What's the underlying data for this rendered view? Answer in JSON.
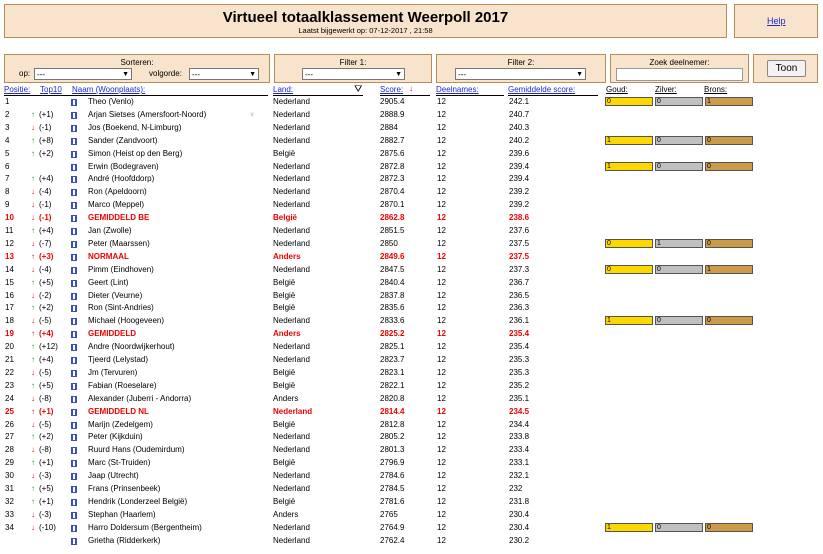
{
  "header": {
    "title": "Virtueel totaalklassement Weerpoll 2017",
    "subtitle": "Laatst bijgewerkt op: 07-12-2017 , 21:58",
    "help": "Help"
  },
  "controls": {
    "sort_label": "Sorteren:",
    "op_label": "op:",
    "op_value": "---",
    "order_label": "volgorde:",
    "order_value": "---",
    "filter1_label": "Filter 1:",
    "filter1_value": "---",
    "filter2_label": "Filter 2:",
    "filter2_value": "---",
    "search_label": "Zoek deelnemer:",
    "search_value": "",
    "toon_label": "Toon"
  },
  "columns": {
    "positie": "Positie:",
    "top10": "Top10",
    "naam": "Naam (Woonplaats):",
    "land": "Land:",
    "score": "Score:",
    "deelnames": "Deelnames:",
    "gemiddelde": "Gemiddelde score:",
    "goud": "Goud:",
    "zilver": "Zilver:",
    "brons": "Brons:"
  },
  "colors": {
    "panel": "#f8e4cc",
    "link": "#1a2ccb",
    "highlight": "#ee0000",
    "up": "#16a016",
    "down": "#d01010"
  },
  "rows": [
    {
      "pos": "1",
      "change": "",
      "dir": "",
      "name": "Theo (Venlo)",
      "country": "Nederland",
      "score": "2905.4",
      "games": "12",
      "avg": "242.1",
      "medals": [
        "0",
        "0",
        "1"
      ],
      "red": false,
      "trophy": false
    },
    {
      "pos": "2",
      "change": "(+1)",
      "dir": "up",
      "name": "Arjan Sietses (Amersfoort-Noord)",
      "country": "Nederland",
      "score": "2888.9",
      "games": "12",
      "avg": "240.7",
      "medals": null,
      "red": false,
      "trophy": true
    },
    {
      "pos": "3",
      "change": "(-1)",
      "dir": "down",
      "name": "Jos (Boekend, N-Limburg)",
      "country": "Nederland",
      "score": "2884",
      "games": "12",
      "avg": "240.3",
      "medals": null,
      "red": false,
      "trophy": false
    },
    {
      "pos": "4",
      "change": "(+8)",
      "dir": "up",
      "name": "Sander (Zandvoort)",
      "country": "Nederland",
      "score": "2882.7",
      "games": "12",
      "avg": "240.2",
      "medals": [
        "1",
        "0",
        "0"
      ],
      "red": false,
      "trophy": false
    },
    {
      "pos": "5",
      "change": "(+2)",
      "dir": "up",
      "name": "Simon (Heist op den Berg)",
      "country": "België",
      "score": "2875.6",
      "games": "12",
      "avg": "239.6",
      "medals": null,
      "red": false,
      "trophy": false
    },
    {
      "pos": "6",
      "change": "",
      "dir": "",
      "name": "Erwin (Bodegraven)",
      "country": "Nederland",
      "score": "2872.8",
      "games": "12",
      "avg": "239.4",
      "medals": [
        "1",
        "0",
        "0"
      ],
      "red": false,
      "trophy": false
    },
    {
      "pos": "7",
      "change": "(+4)",
      "dir": "up",
      "name": "André (Hoofddorp)",
      "country": "Nederland",
      "score": "2872.3",
      "games": "12",
      "avg": "239.4",
      "medals": null,
      "red": false,
      "trophy": false
    },
    {
      "pos": "8",
      "change": "(-4)",
      "dir": "down",
      "name": "Ron (Apeldoorn)",
      "country": "Nederland",
      "score": "2870.4",
      "games": "12",
      "avg": "239.2",
      "medals": null,
      "red": false,
      "trophy": false
    },
    {
      "pos": "9",
      "change": "(-1)",
      "dir": "down",
      "name": "Marco (Meppel)",
      "country": "Nederland",
      "score": "2870.1",
      "games": "12",
      "avg": "239.2",
      "medals": null,
      "red": false,
      "trophy": false
    },
    {
      "pos": "10",
      "change": "(-1)",
      "dir": "down",
      "name": "GEMIDDELD BE",
      "country": "België",
      "score": "2862.8",
      "games": "12",
      "avg": "238.6",
      "medals": null,
      "red": true,
      "trophy": false
    },
    {
      "pos": "11",
      "change": "(+4)",
      "dir": "up",
      "name": "Jan (Zwolle)",
      "country": "Nederland",
      "score": "2851.5",
      "games": "12",
      "avg": "237.6",
      "medals": null,
      "red": false,
      "trophy": false
    },
    {
      "pos": "12",
      "change": "(-7)",
      "dir": "down",
      "name": "Peter (Maarssen)",
      "country": "Nederland",
      "score": "2850",
      "games": "12",
      "avg": "237.5",
      "medals": [
        "0",
        "1",
        "0"
      ],
      "red": false,
      "trophy": false
    },
    {
      "pos": "13",
      "change": "(+3)",
      "dir": "up",
      "name": "NORMAAL",
      "country": "Anders",
      "score": "2849.6",
      "games": "12",
      "avg": "237.5",
      "medals": null,
      "red": true,
      "trophy": false
    },
    {
      "pos": "14",
      "change": "(-4)",
      "dir": "down",
      "name": "Pimm (Eindhoven)",
      "country": "Nederland",
      "score": "2847.5",
      "games": "12",
      "avg": "237.3",
      "medals": [
        "0",
        "0",
        "1"
      ],
      "red": false,
      "trophy": false
    },
    {
      "pos": "15",
      "change": "(+5)",
      "dir": "up",
      "name": "Geert (Lint)",
      "country": "België",
      "score": "2840.4",
      "games": "12",
      "avg": "236.7",
      "medals": null,
      "red": false,
      "trophy": false
    },
    {
      "pos": "16",
      "change": "(-2)",
      "dir": "down",
      "name": "Dieter (Veurne)",
      "country": "België",
      "score": "2837.8",
      "games": "12",
      "avg": "236.5",
      "medals": null,
      "red": false,
      "trophy": false
    },
    {
      "pos": "17",
      "change": "(+2)",
      "dir": "up",
      "name": "Ron (Sint-Andries)",
      "country": "België",
      "score": "2835.6",
      "games": "12",
      "avg": "236.3",
      "medals": null,
      "red": false,
      "trophy": false
    },
    {
      "pos": "18",
      "change": "(-5)",
      "dir": "down",
      "name": "Michael (Hoogeveen)",
      "country": "Nederland",
      "score": "2833.6",
      "games": "12",
      "avg": "236.1",
      "medals": [
        "1",
        "0",
        "0"
      ],
      "red": false,
      "trophy": false
    },
    {
      "pos": "19",
      "change": "(+4)",
      "dir": "up",
      "name": "GEMIDDELD",
      "country": "Anders",
      "score": "2825.2",
      "games": "12",
      "avg": "235.4",
      "medals": null,
      "red": true,
      "trophy": false
    },
    {
      "pos": "20",
      "change": "(+12)",
      "dir": "up",
      "name": "Andre (Noordwijkerhout)",
      "country": "Nederland",
      "score": "2825.1",
      "games": "12",
      "avg": "235.4",
      "medals": null,
      "red": false,
      "trophy": false
    },
    {
      "pos": "21",
      "change": "(+4)",
      "dir": "up",
      "name": "Tjeerd (Lelystad)",
      "country": "Nederland",
      "score": "2823.7",
      "games": "12",
      "avg": "235.3",
      "medals": null,
      "red": false,
      "trophy": false
    },
    {
      "pos": "22",
      "change": "(-5)",
      "dir": "down",
      "name": "Jm (Tervuren)",
      "country": "België",
      "score": "2823.1",
      "games": "12",
      "avg": "235.3",
      "medals": null,
      "red": false,
      "trophy": false
    },
    {
      "pos": "23",
      "change": "(+5)",
      "dir": "up",
      "name": "Fabian (Roeselare)",
      "country": "België",
      "score": "2822.1",
      "games": "12",
      "avg": "235.2",
      "medals": null,
      "red": false,
      "trophy": false
    },
    {
      "pos": "24",
      "change": "(-8)",
      "dir": "down",
      "name": "Alexander (Juberri - Andorra)",
      "country": "Anders",
      "score": "2820.8",
      "games": "12",
      "avg": "235.1",
      "medals": null,
      "red": false,
      "trophy": false
    },
    {
      "pos": "25",
      "change": "(+1)",
      "dir": "up",
      "name": "GEMIDDELD NL",
      "country": "Nederland",
      "score": "2814.4",
      "games": "12",
      "avg": "234.5",
      "medals": null,
      "red": true,
      "trophy": false
    },
    {
      "pos": "26",
      "change": "(-5)",
      "dir": "down",
      "name": "Marijn (Zedelgem)",
      "country": "België",
      "score": "2812.8",
      "games": "12",
      "avg": "234.4",
      "medals": null,
      "red": false,
      "trophy": false
    },
    {
      "pos": "27",
      "change": "(+2)",
      "dir": "up",
      "name": "Peter (Kijkduin)",
      "country": "Nederland",
      "score": "2805.2",
      "games": "12",
      "avg": "233.8",
      "medals": null,
      "red": false,
      "trophy": false
    },
    {
      "pos": "28",
      "change": "(-8)",
      "dir": "down",
      "name": "Ruurd Hans (Oudemirdum)",
      "country": "Nederland",
      "score": "2801.3",
      "games": "12",
      "avg": "233.4",
      "medals": null,
      "red": false,
      "trophy": false
    },
    {
      "pos": "29",
      "change": "(+1)",
      "dir": "up",
      "name": "Marc (St-Truiden)",
      "country": "België",
      "score": "2796.9",
      "games": "12",
      "avg": "233.1",
      "medals": null,
      "red": false,
      "trophy": false
    },
    {
      "pos": "30",
      "change": "(-3)",
      "dir": "down",
      "name": "Jaap (Utrecht)",
      "country": "Nederland",
      "score": "2784.6",
      "games": "12",
      "avg": "232.1",
      "medals": null,
      "red": false,
      "trophy": false
    },
    {
      "pos": "31",
      "change": "(+5)",
      "dir": "up",
      "name": "Frans (Prinsenbeek)",
      "country": "Nederland",
      "score": "2784.5",
      "games": "12",
      "avg": "232",
      "medals": null,
      "red": false,
      "trophy": false
    },
    {
      "pos": "32",
      "change": "(+1)",
      "dir": "up",
      "name": "Hendrik (Londerzeel België)",
      "country": "België",
      "score": "2781.6",
      "games": "12",
      "avg": "231.8",
      "medals": null,
      "red": false,
      "trophy": false
    },
    {
      "pos": "33",
      "change": "(-3)",
      "dir": "down",
      "name": "Stephan (Haarlem)",
      "country": "Anders",
      "score": "2765",
      "games": "12",
      "avg": "230.4",
      "medals": null,
      "red": false,
      "trophy": false
    },
    {
      "pos": "34",
      "change": "(-10)",
      "dir": "down",
      "name": "Harro Doldersum (Bergentheim)",
      "country": "Nederland",
      "score": "2764.9",
      "games": "12",
      "avg": "230.4",
      "medals": [
        "1",
        "0",
        "0"
      ],
      "red": false,
      "trophy": false
    },
    {
      "pos": "",
      "change": "",
      "dir": "",
      "name": "Grietha (Ridderkerk)",
      "country": "Nederland",
      "score": "2762.4",
      "games": "12",
      "avg": "230.2",
      "medals": null,
      "red": false,
      "trophy": false
    }
  ]
}
